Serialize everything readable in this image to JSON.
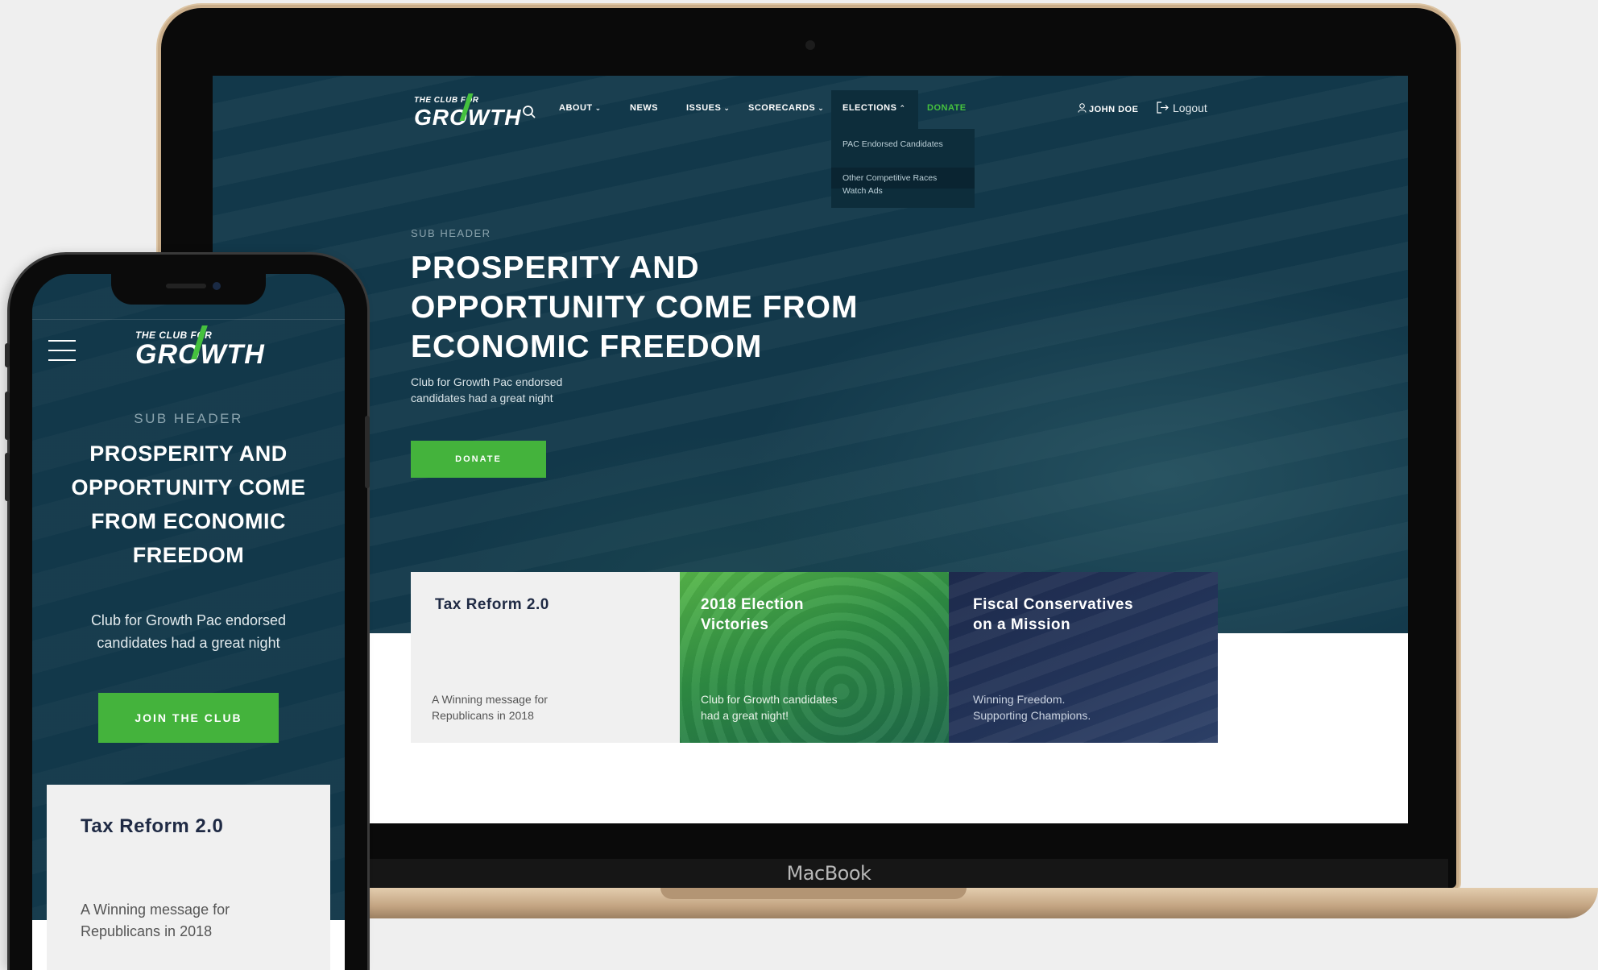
{
  "desktop": {
    "logo": {
      "line1": "THE CLUB FOR",
      "line2": "GROWTH"
    },
    "nav": {
      "about": "ABOUT",
      "news": "NEWS",
      "issues": "ISSUES",
      "scorecards": "SCORECARDS",
      "elections": "ELECTIONS",
      "donate": "DONATE",
      "user": "JOHN DOE",
      "logout": "Logout"
    },
    "elections_menu": [
      "PAC Endorsed Candidates",
      "Other Competitive Races",
      "Watch Ads"
    ],
    "hero": {
      "subheader": "SUB HEADER",
      "title_lines": [
        "PROSPERITY AND",
        "OPPORTUNITY COME FROM",
        "ECONOMIC FREEDOM"
      ],
      "subtitle_lines": [
        "Club for Growth Pac endorsed",
        "candidates had a great night"
      ],
      "button": "DONATE"
    },
    "cards": [
      {
        "title_lines": [
          "Tax Reform 2.0",
          ""
        ],
        "desc_lines": [
          "A Winning message for",
          "Republicans in 2018"
        ]
      },
      {
        "title_lines": [
          "2018 Election",
          "Victories"
        ],
        "desc_lines": [
          "Club for Growth candidates",
          "had a great night!"
        ]
      },
      {
        "title_lines": [
          "Fiscal Conservatives",
          "on a Mission"
        ],
        "desc_lines": [
          "Winning Freedom.",
          "Supporting Champions."
        ]
      }
    ],
    "device_label": "MacBook"
  },
  "mobile": {
    "logo": {
      "line1": "THE CLUB FOR",
      "line2": "GROWTH"
    },
    "subheader": "SUB HEADER",
    "title_lines": [
      "PROSPERITY AND",
      "OPPORTUNITY COME",
      "FROM ECONOMIC",
      "FREEDOM"
    ],
    "subtitle_lines": [
      "Club for Growth Pac endorsed",
      "candidates had a great night"
    ],
    "button": "JOIN THE CLUB",
    "card": {
      "title": "Tax Reform 2.0",
      "desc_lines": [
        "A Winning message for",
        "Republicans in 2018"
      ]
    }
  },
  "colors": {
    "brand_green": "#44b33c",
    "hero_navy": "#12384a",
    "card_light": "#f0f0f0",
    "card_navy": "#1d2a4c"
  },
  "icons": [
    "search-icon",
    "chevron-down-icon",
    "chevron-up-icon",
    "user-icon",
    "logout-icon",
    "hamburger-menu-icon"
  ]
}
